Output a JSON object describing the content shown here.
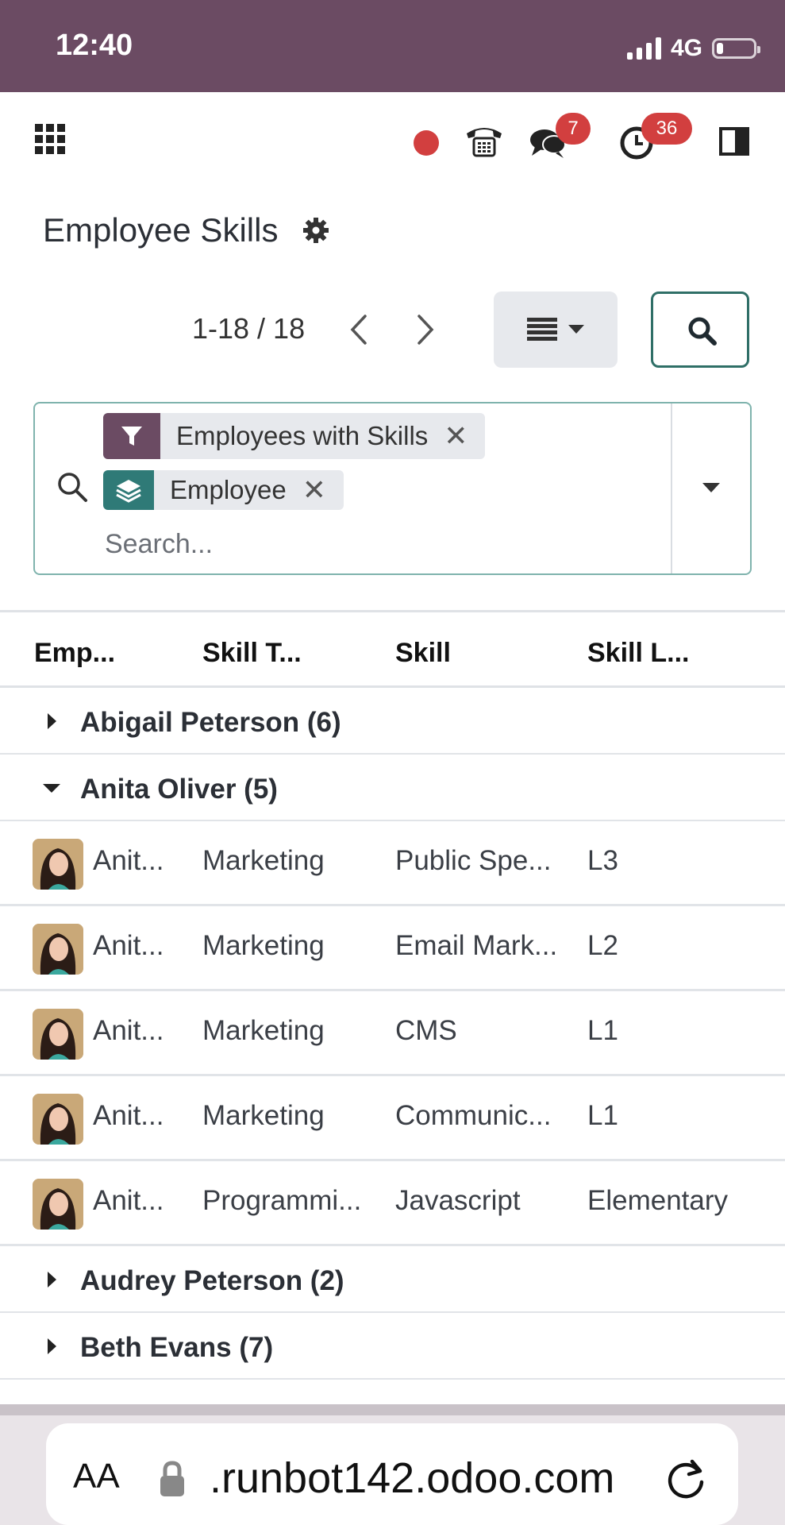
{
  "status_bar": {
    "time": "12:40",
    "network": "4G"
  },
  "navbar": {
    "chat_badge": "7",
    "activity_badge": "36",
    "colors": {
      "brand": "#6b4b63",
      "badge": "#d23f3f",
      "accent": "#2f7a77"
    }
  },
  "page": {
    "title": "Employee Skills"
  },
  "pager": {
    "value": "1-18 / 18"
  },
  "search": {
    "placeholder": "Search...",
    "facets": [
      {
        "type": "filter",
        "icon": "filter-icon",
        "label": "Employees with Skills"
      },
      {
        "type": "group_by",
        "icon": "layers-icon",
        "label": "Employee"
      }
    ]
  },
  "table": {
    "columns": [
      "Emp...",
      "Skill T...",
      "Skill",
      "Skill L..."
    ],
    "groups": [
      {
        "label": "Abigail Peterson (6)",
        "expanded": false
      },
      {
        "label": "Anita Oliver (5)",
        "expanded": true
      },
      {
        "label": "Audrey Peterson (2)",
        "expanded": false
      },
      {
        "label": "Beth Evans (7)",
        "expanded": false
      }
    ],
    "rows": [
      {
        "employee": "Anit...",
        "skill_type": "Marketing",
        "skill": "Public Spe...",
        "level": "L3"
      },
      {
        "employee": "Anit...",
        "skill_type": "Marketing",
        "skill": "Email Mark...",
        "level": "L2"
      },
      {
        "employee": "Anit...",
        "skill_type": "Marketing",
        "skill": "CMS",
        "level": "L1"
      },
      {
        "employee": "Anit...",
        "skill_type": "Marketing",
        "skill": "Communic...",
        "level": "L1"
      },
      {
        "employee": "Anit...",
        "skill_type": "Programmi...",
        "skill": "Javascript",
        "level": "Elementary"
      }
    ]
  },
  "browser": {
    "text_size": "AA",
    "url": ".runbot142.odoo.com"
  }
}
